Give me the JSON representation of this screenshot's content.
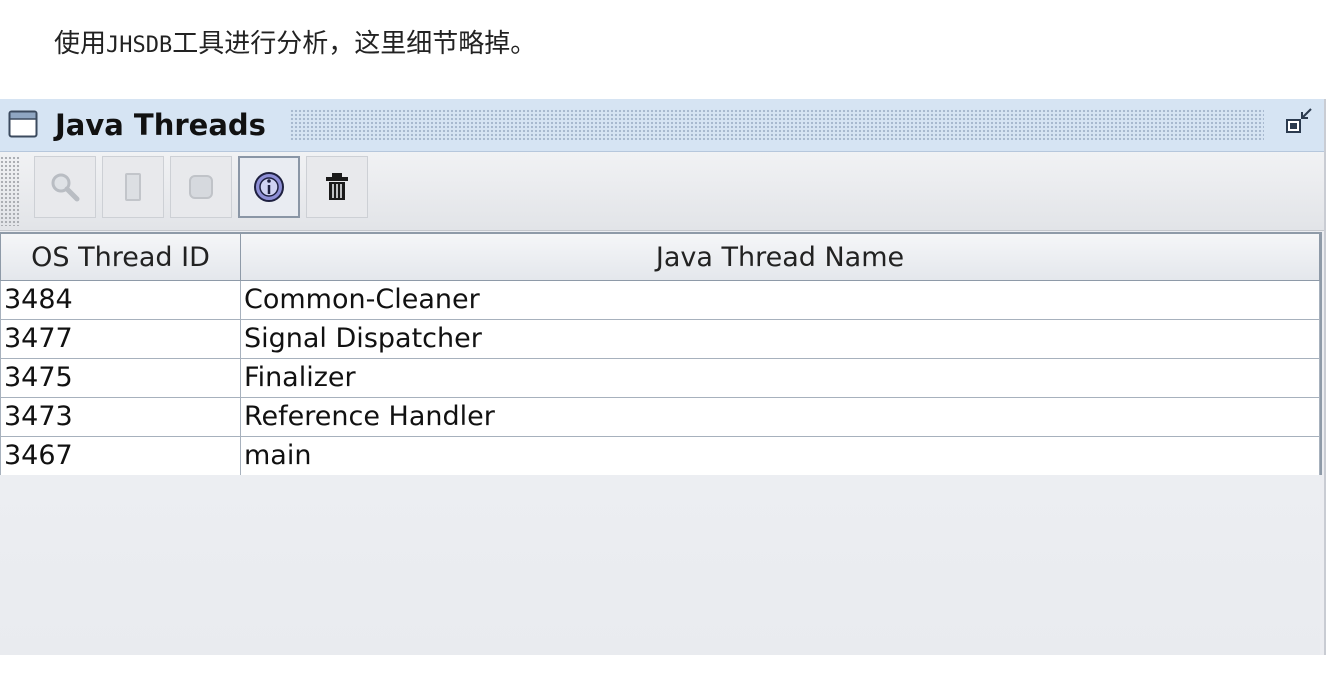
{
  "caption": {
    "prefix": "使用",
    "tool": "JHSDB",
    "suffix": "工具进行分析，这里细节略掉。"
  },
  "window": {
    "title": "Java Threads",
    "title_icon": "window-icon",
    "restore_icon": "restore-icon"
  },
  "toolbar": {
    "buttons": [
      {
        "icon": "magnifier-icon",
        "enabled": false
      },
      {
        "icon": "stack-icon",
        "enabled": false
      },
      {
        "icon": "memory-icon",
        "enabled": false
      },
      {
        "icon": "info-icon",
        "enabled": true,
        "active": true
      },
      {
        "icon": "trash-icon",
        "enabled": true
      }
    ]
  },
  "table": {
    "columns": [
      "OS Thread ID",
      "Java Thread Name"
    ],
    "rows": [
      {
        "id": "3484",
        "name": "Common-Cleaner"
      },
      {
        "id": "3477",
        "name": "Signal Dispatcher"
      },
      {
        "id": "3475",
        "name": "Finalizer"
      },
      {
        "id": "3473",
        "name": "Reference Handler"
      },
      {
        "id": "3467",
        "name": "main"
      }
    ]
  },
  "colors": {
    "titlebar": "#d6e4f3",
    "panel": "#ecedf1",
    "grid": "#8e9aa8"
  }
}
